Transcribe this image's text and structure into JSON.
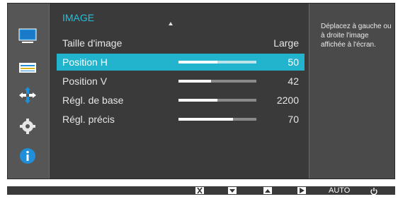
{
  "menu": {
    "header": "IMAGE",
    "items": [
      {
        "label": "Taille d'image",
        "value": "Large",
        "level": null,
        "active": false
      },
      {
        "label": "Position H",
        "value": "50",
        "level": 0.5,
        "active": true
      },
      {
        "label": "Position V",
        "value": "42",
        "level": 0.42,
        "active": false
      },
      {
        "label": "Régl. de base",
        "value": "2200",
        "level": 0.5,
        "active": false
      },
      {
        "label": "Régl. précis",
        "value": "70",
        "level": 0.7,
        "active": false
      }
    ]
  },
  "help": {
    "text": "Déplacez à gauche ou à droite l'image affichée à l'écran."
  },
  "sidebar": {
    "icons": [
      "display-icon",
      "picture-icon",
      "position-icon",
      "settings-icon",
      "info-icon"
    ],
    "active_icon": "position-icon"
  },
  "bottom_bar": {
    "keys": [
      "close-key",
      "down-key",
      "up-key",
      "enter-key",
      "auto-key",
      "power-key"
    ],
    "auto_label": "AUTO"
  },
  "colors": {
    "accent": "#21b4cc",
    "header": "#21c1de",
    "panel": "#3a3a3a",
    "background": "#4a4a4a"
  }
}
